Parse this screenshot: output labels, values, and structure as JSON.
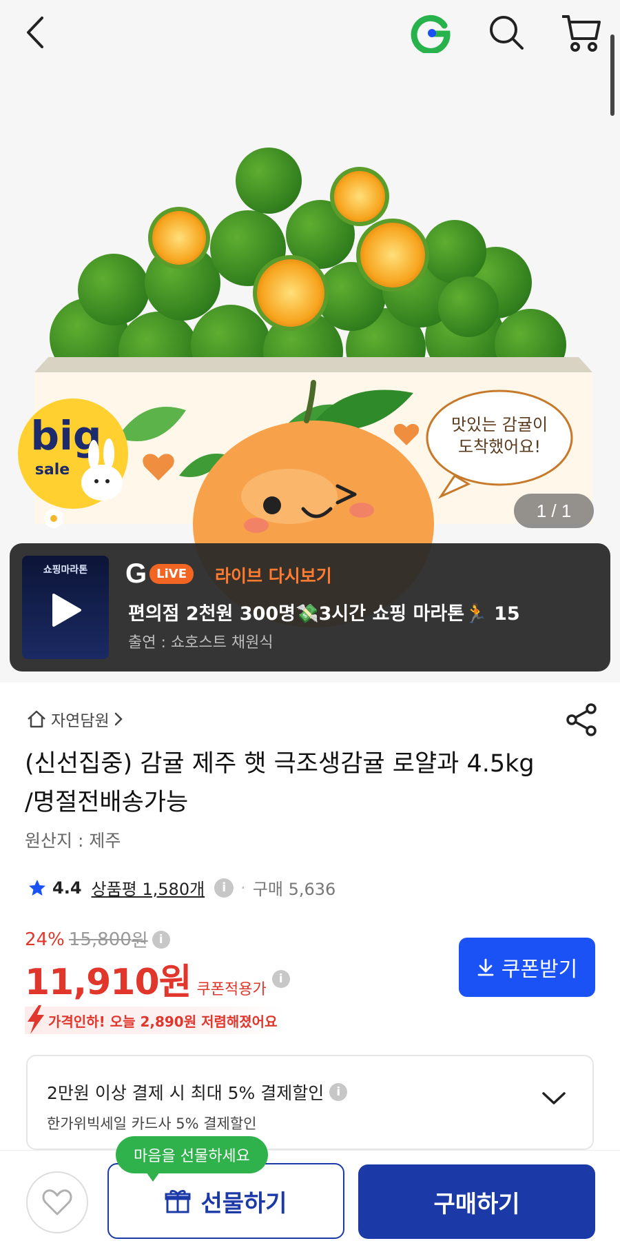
{
  "hero": {
    "box_text_line1": "맛있는 감귤이",
    "box_text_line2": "도착했어요!",
    "badge_big": "big",
    "badge_sale": "sale",
    "image_counter": "1 / 1"
  },
  "topbar": {
    "icons": [
      "back-icon",
      "g-logo-icon",
      "search-icon",
      "cart-icon"
    ]
  },
  "live": {
    "thumb_title": "쇼핑마라톤",
    "logo_g": "G",
    "logo_pill": "LiVE",
    "label": "라이브 다시보기",
    "title": "편의점 2천원 300명💸3시간 쇼핑 마라톤🏃 15",
    "host": "출연 : 쇼호스트 채원식"
  },
  "product": {
    "store": "자연담원",
    "title": "(신선집중) 감귤 제주 햇 극조생감귤 로얄과 4.5kg /명절전배송가능",
    "origin": "원산지 : 제주",
    "rating": "4.4",
    "reviews": "상품평 1,580개",
    "purchases": "구매 5,636",
    "discount_pct": "24%",
    "original_price": "15,800",
    "original_unit": "원",
    "price": "11,910원",
    "price_note": "쿠폰적용가",
    "coupon_button": "쿠폰받기",
    "price_drop": "가격인하! 오늘 2,890원 저렴해졌어요"
  },
  "card_discount": {
    "main": "2만원 이상 결제 시 최대 5% 결제할인",
    "sub": "한가위빅세일 카드사 5% 결제할인"
  },
  "bottom": {
    "gift_bubble": "마음을 선물하세요",
    "gift_button": "선물하기",
    "buy_button": "구매하기"
  },
  "colors": {
    "accent_blue": "#1b52f5",
    "navy": "#1b3aa8",
    "price_red": "#e0362c",
    "live_orange": "#ff7b30",
    "bubble_green": "#2fb24b"
  }
}
